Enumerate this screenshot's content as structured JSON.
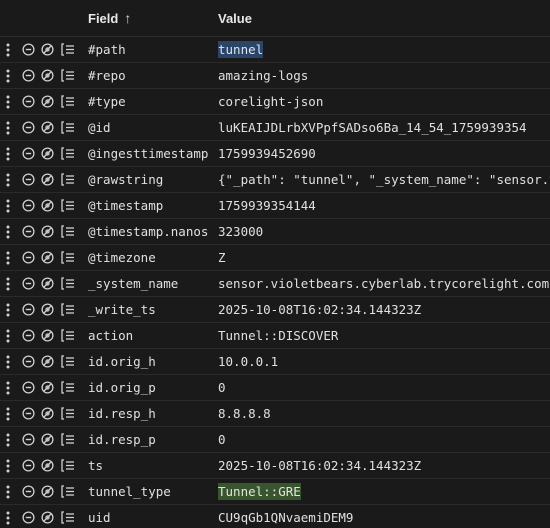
{
  "header": {
    "field_label": "Field",
    "sort_indicator": "↑",
    "value_label": "Value"
  },
  "icons": {
    "row_menu": "vertical-dots-icon",
    "exclude": "minus-circle-icon",
    "hide": "eye-off-icon",
    "filter": "filter-list-icon"
  },
  "colors": {
    "background": "#1a1a1a",
    "highlight_blue": "#2c4468",
    "highlight_green": "#39552f"
  },
  "rows": [
    {
      "field": "#path",
      "value": "tunnel",
      "highlight": "blue"
    },
    {
      "field": "#repo",
      "value": "amazing-logs"
    },
    {
      "field": "#type",
      "value": "corelight-json"
    },
    {
      "field": "@id",
      "value": "luKEAIJDLrbXVPpfSADso6Ba_14_54_1759939354"
    },
    {
      "field": "@ingesttimestamp",
      "value": "1759939452690"
    },
    {
      "field": "@rawstring",
      "value": "{\"_path\": \"tunnel\", \"_system_name\": \"sensor.vi"
    },
    {
      "field": "@timestamp",
      "value": "1759939354144"
    },
    {
      "field": "@timestamp.nanos",
      "value": "323000"
    },
    {
      "field": "@timezone",
      "value": "Z"
    },
    {
      "field": "_system_name",
      "value": "sensor.violetbears.cyberlab.trycorelight.com"
    },
    {
      "field": "_write_ts",
      "value": "2025-10-08T16:02:34.144323Z"
    },
    {
      "field": "action",
      "value": "Tunnel::DISCOVER"
    },
    {
      "field": "id.orig_h",
      "value": "10.0.0.1"
    },
    {
      "field": "id.orig_p",
      "value": "0"
    },
    {
      "field": "id.resp_h",
      "value": "8.8.8.8"
    },
    {
      "field": "id.resp_p",
      "value": "0"
    },
    {
      "field": "ts",
      "value": "2025-10-08T16:02:34.144323Z"
    },
    {
      "field": "tunnel_type",
      "value": "Tunnel::GRE",
      "highlight": "green"
    },
    {
      "field": "uid",
      "value": "CU9qGb1QNvaemiDEM9"
    }
  ]
}
